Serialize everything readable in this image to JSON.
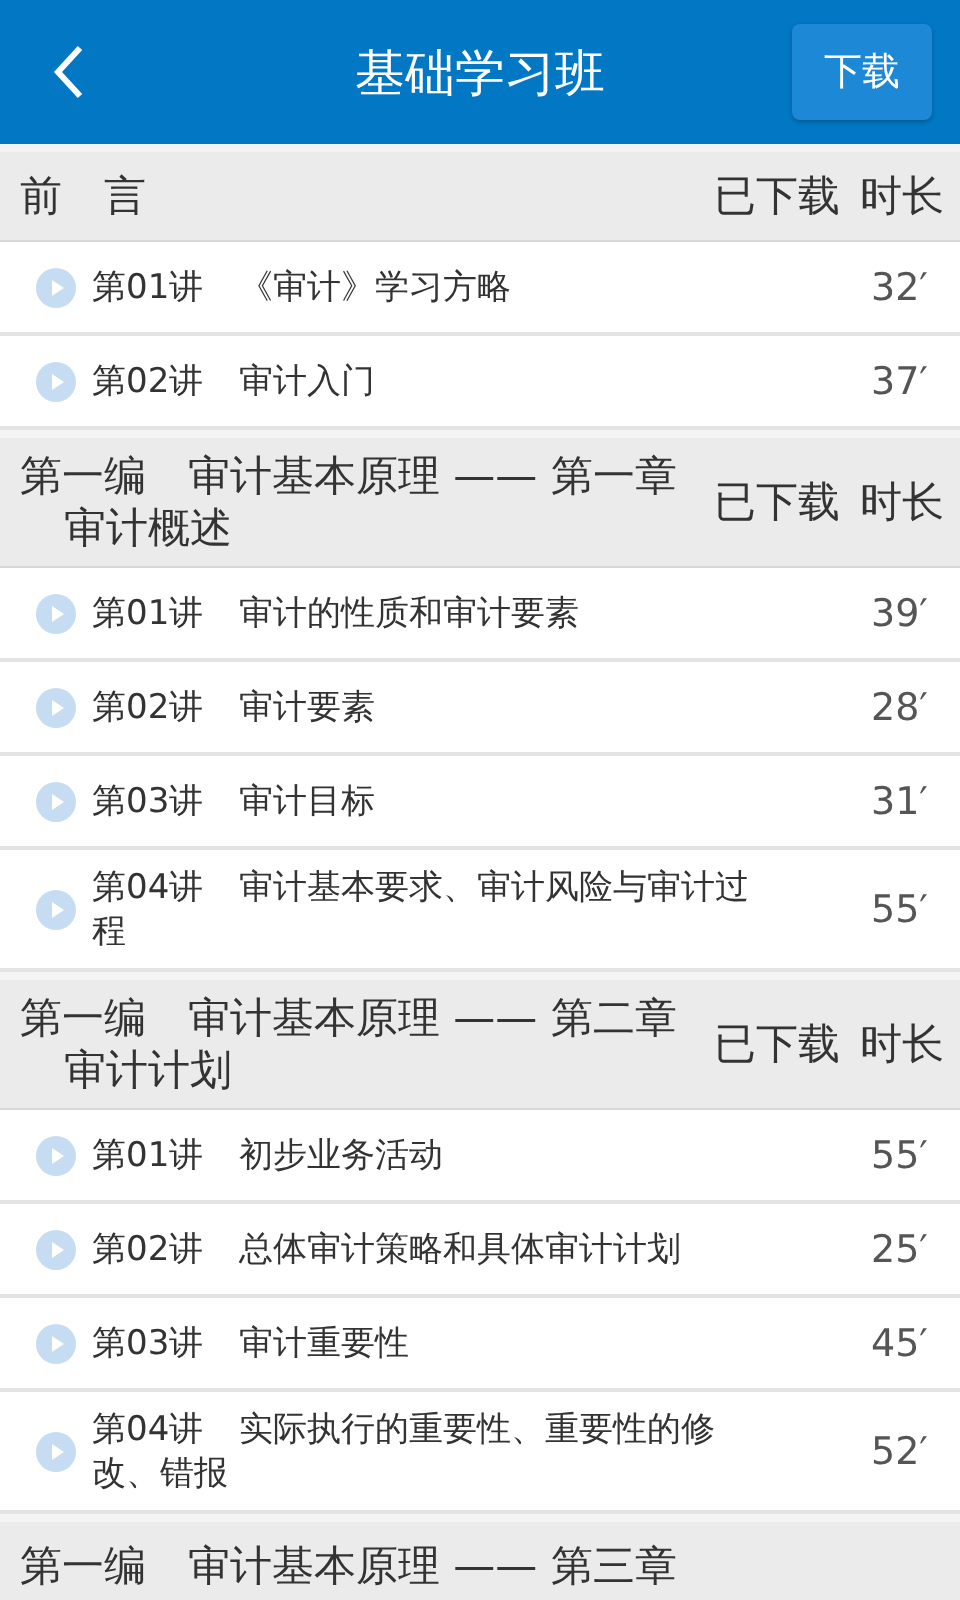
{
  "header": {
    "title": "基础学习班",
    "download_button": "下载"
  },
  "sections": [
    {
      "title": "前　言",
      "downloaded_label": "已下载",
      "duration_label": "时长",
      "lectures": [
        {
          "number": "第01讲",
          "title": "《审计》学习方略",
          "duration": "32′"
        },
        {
          "number": "第02讲",
          "title": "审计入门",
          "duration": "37′"
        }
      ]
    },
    {
      "title": "第一编　审计基本原理 —— 第一章审计概述",
      "downloaded_label": "已下载",
      "duration_label": "时长",
      "lectures": [
        {
          "number": "第01讲",
          "title": "审计的性质和审计要素",
          "duration": "39′"
        },
        {
          "number": "第02讲",
          "title": "审计要素",
          "duration": "28′"
        },
        {
          "number": "第03讲",
          "title": "审计目标",
          "duration": "31′"
        },
        {
          "number": "第04讲",
          "title": "审计基本要求、审计风险与审计过程",
          "duration": "55′"
        }
      ]
    },
    {
      "title": "第一编　审计基本原理 —— 第二章审计计划",
      "downloaded_label": "已下载",
      "duration_label": "时长",
      "lectures": [
        {
          "number": "第01讲",
          "title": "初步业务活动",
          "duration": "55′"
        },
        {
          "number": "第02讲",
          "title": "总体审计策略和具体审计计划",
          "duration": "25′"
        },
        {
          "number": "第03讲",
          "title": "审计重要性",
          "duration": "45′"
        },
        {
          "number": "第04讲",
          "title": "实际执行的重要性、重要性的修改、错报",
          "duration": "52′"
        }
      ]
    },
    {
      "title": "第一编　审计基本原理 —— 第三章"
    }
  ]
}
